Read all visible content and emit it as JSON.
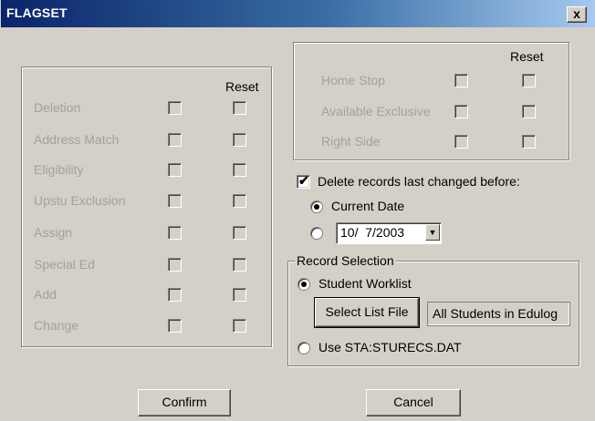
{
  "window": {
    "title": "FLAGSET",
    "close_label": "x"
  },
  "left_group": {
    "reset_header": "Reset",
    "rows": [
      {
        "label": "Deletion"
      },
      {
        "label": "Address Match"
      },
      {
        "label": "Eligibility"
      },
      {
        "label": "Upstu Exclusion"
      },
      {
        "label": "Assign"
      },
      {
        "label": "Special Ed"
      },
      {
        "label": "Add"
      },
      {
        "label": "Change"
      }
    ]
  },
  "right_group": {
    "reset_header": "Reset",
    "rows": [
      {
        "label": "Home Stop"
      },
      {
        "label": "Available Exclusive"
      },
      {
        "label": "Right Side"
      }
    ]
  },
  "delete_records": {
    "label": "Delete records last changed before:",
    "checked": true,
    "current_date_label": "Current Date",
    "date_value": "10/  7/2003"
  },
  "record_selection": {
    "legend": "Record Selection",
    "student_worklist_label": "Student Worklist",
    "select_list_file_label": "Select List File",
    "list_file_value": "All Students in Edulog",
    "use_sta_label": "Use STA:STURECS.DAT"
  },
  "buttons": {
    "confirm": "Confirm",
    "cancel": "Cancel"
  }
}
